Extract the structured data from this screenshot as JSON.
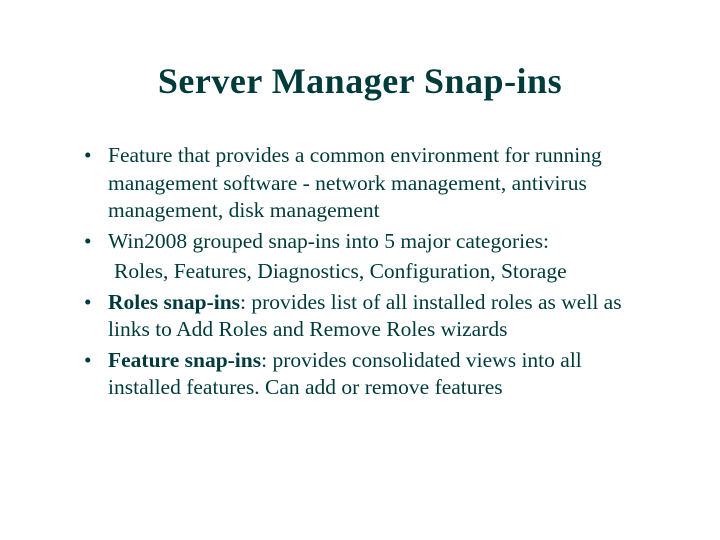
{
  "title": "Server Manager Snap-ins",
  "bullets": {
    "b1_text": "Feature that provides a common environment for running management software - network management, antivirus management, disk management",
    "b2_text": "Win2008 grouped snap-ins into 5 major categories:",
    "b2_sub": "Roles, Features, Diagnostics, Configuration, Storage",
    "b3_label": "Roles snap-ins",
    "b3_rest": ": provides list of all installed roles as well as links to Add Roles and Remove Roles wizards",
    "b4_label": "Feature snap-ins",
    "b4_rest": ": provides consolidated views into all installed features. Can add or remove features"
  },
  "dot": "•"
}
